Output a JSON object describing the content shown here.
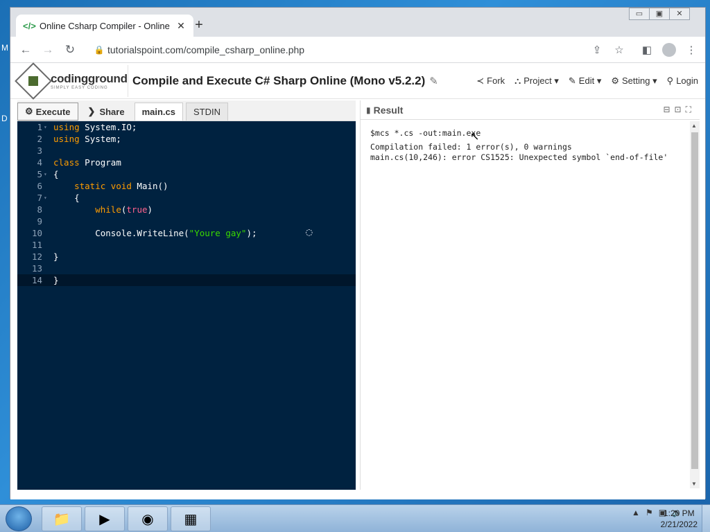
{
  "desktop": {
    "edge_letters": [
      "M",
      "D"
    ]
  },
  "browser": {
    "tab_title": "Online Csharp Compiler - Online",
    "tab_favicon": "</>",
    "url": "tutorialspoint.com/compile_csharp_online.php",
    "window_controls": [
      "minimize",
      "maximize",
      "close"
    ]
  },
  "site": {
    "logo_text": "codingground",
    "logo_sub": "SIMPLY EASY CODING",
    "title": "Compile and Execute C# Sharp Online (Mono v5.2.2)",
    "menu": [
      {
        "label": "Fork",
        "icon": "fork-icon",
        "glyph": "≺"
      },
      {
        "label": "Project",
        "icon": "sitemap-icon",
        "glyph": "⛬",
        "dropdown": true
      },
      {
        "label": "Edit",
        "icon": "edit-icon",
        "glyph": "✎",
        "dropdown": true
      },
      {
        "label": "Setting",
        "icon": "gear-icon",
        "glyph": "⚙",
        "dropdown": true
      },
      {
        "label": "Login",
        "icon": "user-icon",
        "glyph": "👤"
      }
    ]
  },
  "editor": {
    "execute_label": "Execute",
    "share_label": "Share",
    "file_tab": "main.cs",
    "stdin_tab": "STDIN",
    "current_line": 14
  },
  "result": {
    "title": "Result",
    "lines": [
      "$mcs *.cs -out:main.exe",
      "",
      "Compilation failed: 1 error(s), 0 warnings",
      "main.cs(10,246): error CS1525: Unexpected symbol `end-of-file'"
    ]
  },
  "taskbar": {
    "clock_time": "1:20 PM",
    "clock_date": "2/21/2022",
    "pinned": [
      "explorer-icon",
      "media-player-icon",
      "chrome-icon",
      "network-monitor-icon"
    ]
  }
}
